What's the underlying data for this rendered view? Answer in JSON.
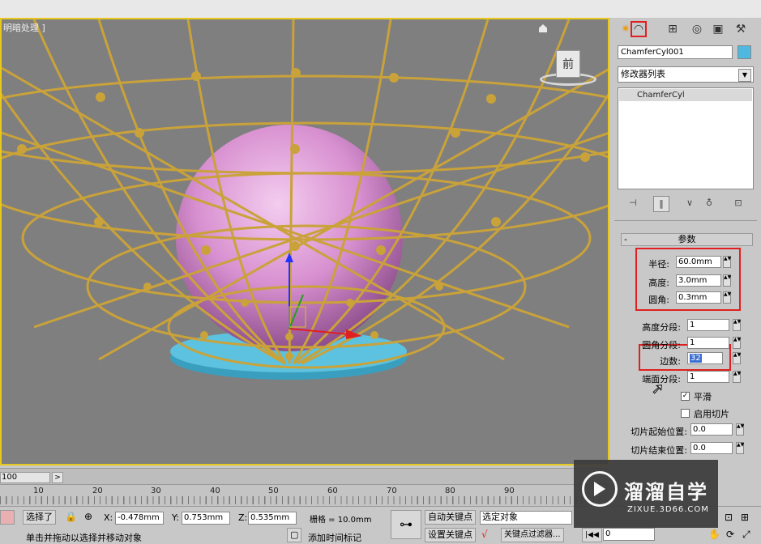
{
  "viewport": {
    "label": "明暗处理 ]",
    "viewcube_label": "前"
  },
  "panel": {
    "tabs": [
      {
        "icon": "create-star-icon"
      },
      {
        "icon": "modify-arc-icon"
      },
      {
        "icon": "hierarchy-icon"
      },
      {
        "icon": "motion-icon"
      },
      {
        "icon": "display-icon"
      },
      {
        "icon": "utilities-hammer-icon"
      }
    ],
    "object_name": "ChamferCyl001",
    "object_color": "#4fb8e0",
    "modifier_list": "修改器列表",
    "stack_item": "ChamferCyl",
    "rollout_title": "参数",
    "rollout_toggle": "-",
    "params": {
      "radius_label": "半径:",
      "radius_value": "60.0mm",
      "height_label": "高度:",
      "height_value": "3.0mm",
      "fillet_label": "圆角:",
      "fillet_value": "0.3mm",
      "height_segs_label": "高度分段:",
      "height_segs_value": "1",
      "fillet_segs_label": "圆角分段:",
      "fillet_segs_value": "1",
      "sides_label": "边数:",
      "sides_value": "32",
      "cap_segs_label": "端面分段:",
      "cap_segs_value": "1",
      "smooth_label": "平滑",
      "smooth_checked": "✓",
      "slice_label": "启用切片",
      "slice_from_label": "切片起始位置:",
      "slice_from_value": "0.0",
      "slice_to_label": "切片结束位置:",
      "slice_to_value": "0.0"
    },
    "highlight_color": "#e02020"
  },
  "timeline": {
    "frame_box": "100",
    "arrow": ">",
    "ticks": [
      "10",
      "20",
      "30",
      "40",
      "50",
      "60",
      "70",
      "80",
      "90"
    ]
  },
  "status": {
    "selected": "选择了",
    "x_label": "X:",
    "x_value": "-0.478mm",
    "y_label": "Y:",
    "y_value": "0.753mm",
    "z_label": "Z:",
    "z_value": "0.535mm",
    "grid": "栅格 = 10.0mm",
    "auto_key": "自动关键点",
    "set_key": "设置关键点",
    "selected_object": "选定对象",
    "key_filters": "关键点过滤器...",
    "add_time_tag": "添加时间标记",
    "prompt": "单击并拖动以选择并移动对象",
    "frame_value": "0"
  },
  "watermark": {
    "title": "溜溜自学",
    "url": "ZIXUE.3D66.COM"
  }
}
